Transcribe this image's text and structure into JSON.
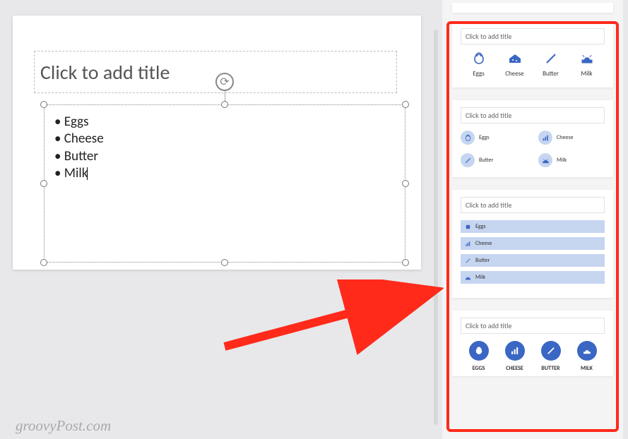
{
  "slide": {
    "title_placeholder": "Click to add title",
    "bullets": [
      "Eggs",
      "Cheese",
      "Butter",
      "Milk"
    ]
  },
  "watermark": "groovyPost.com",
  "design_ideas": {
    "title_placeholder": "Click to add title",
    "card1": {
      "items": [
        {
          "label": "Eggs",
          "icon": "egg-icon"
        },
        {
          "label": "Cheese",
          "icon": "cheese-icon"
        },
        {
          "label": "Butter",
          "icon": "butter-icon"
        },
        {
          "label": "Milk",
          "icon": "cow-icon"
        }
      ]
    },
    "card2": {
      "items": [
        {
          "label": "Eggs",
          "icon": "egg-icon"
        },
        {
          "label": "Cheese",
          "icon": "chart-icon"
        },
        {
          "label": "Butter",
          "icon": "slash-icon"
        },
        {
          "label": "Milk",
          "icon": "cow-icon"
        }
      ]
    },
    "card3": {
      "items": [
        {
          "label": "Eggs",
          "icon": "square-icon"
        },
        {
          "label": "Cheese",
          "icon": "chart-icon"
        },
        {
          "label": "Butter",
          "icon": "slash-icon"
        },
        {
          "label": "Milk",
          "icon": "cow-icon"
        }
      ]
    },
    "card4": {
      "items": [
        {
          "label": "EGGS",
          "icon": "egg-icon"
        },
        {
          "label": "CHEESE",
          "icon": "chart-icon"
        },
        {
          "label": "BUTTER",
          "icon": "slash-icon"
        },
        {
          "label": "MILK",
          "icon": "cow-icon"
        }
      ]
    }
  },
  "colors": {
    "accent": "#3a66c4",
    "accent_light": "#c6d5f0",
    "highlight": "#ff2a1a"
  }
}
